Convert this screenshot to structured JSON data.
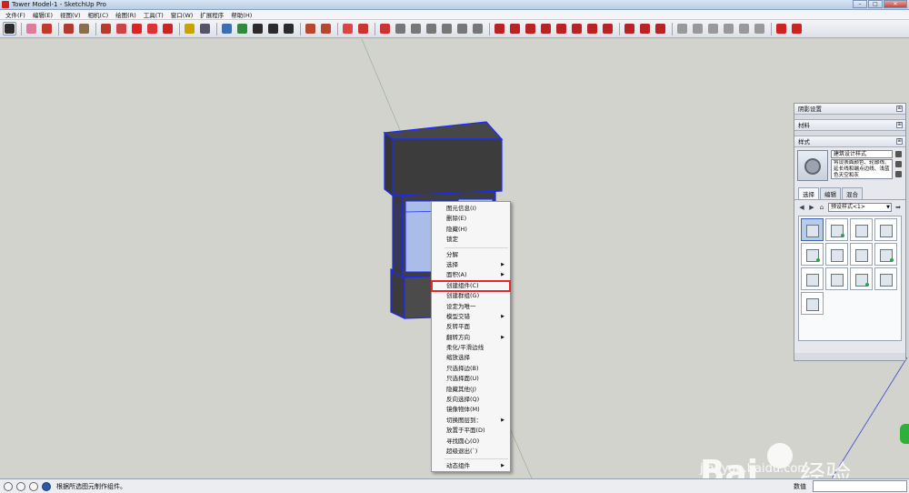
{
  "window": {
    "title": "Tower Model-1 - SketchUp Pro",
    "minimize": "–",
    "maximize": "□",
    "close": "✕"
  },
  "menubar": [
    "文件(F)",
    "编辑(E)",
    "视图(V)",
    "相机(C)",
    "绘图(R)",
    "工具(T)",
    "窗口(W)",
    "扩展程序",
    "帮助(H)"
  ],
  "toolbar": {
    "tools": [
      {
        "icon": "select-arrow-icon",
        "color": "#2b2b2b",
        "active": true
      },
      {
        "icon": "eraser-icon",
        "color": "#e07b9a"
      },
      {
        "icon": "pencil-line-icon",
        "color": "#c23a2a"
      },
      {
        "icon": "arc-icon",
        "color": "#b03a2e"
      },
      {
        "icon": "rectangle-icon",
        "color": "#8c6e4a"
      },
      {
        "icon": "push-pull-icon",
        "color": "#b83a2a"
      },
      {
        "icon": "follow-me-icon",
        "color": "#c44"
      },
      {
        "icon": "move-icon",
        "color": "#d22"
      },
      {
        "icon": "rotate-icon",
        "color": "#d33"
      },
      {
        "icon": "scale-icon",
        "color": "#c22"
      },
      {
        "icon": "tape-measure-icon",
        "color": "#c9a400"
      },
      {
        "icon": "text-icon",
        "color": "#556"
      },
      {
        "icon": "paint-bucket-icon",
        "color": "#3a6fb0"
      },
      {
        "icon": "orbit-icon",
        "color": "#2e8b3a"
      },
      {
        "icon": "pan-icon",
        "color": "#2b2b2b"
      },
      {
        "icon": "zoom-icon",
        "color": "#2b2b2b"
      },
      {
        "icon": "zoom-extents-icon",
        "color": "#2b2b2b"
      },
      {
        "icon": "warehouse-icon",
        "color": "#b5482e"
      },
      {
        "icon": "extension-warehouse-icon",
        "color": "#b5482e"
      },
      {
        "icon": "layout-icon",
        "color": "#d44"
      },
      {
        "icon": "iso-view-icon",
        "color": "#c33"
      },
      {
        "icon": "top-view-icon",
        "color": "#c33"
      },
      {
        "icon": "front-view-icon",
        "color": "#777"
      },
      {
        "icon": "right-view-icon",
        "color": "#777"
      },
      {
        "icon": "back-view-icon",
        "color": "#777"
      },
      {
        "icon": "left-view-icon",
        "color": "#777"
      },
      {
        "icon": "xray-icon",
        "color": "#777"
      },
      {
        "icon": "sandbox-icon",
        "color": "#777"
      },
      {
        "icon": "intersect-icon",
        "color": "#b22"
      },
      {
        "icon": "union-icon",
        "color": "#b22"
      },
      {
        "icon": "subtract-icon",
        "color": "#b22"
      },
      {
        "icon": "trim-icon",
        "color": "#b22"
      },
      {
        "icon": "split-icon",
        "color": "#b22"
      },
      {
        "icon": "outer-shell-icon",
        "color": "#b22"
      },
      {
        "icon": "section-plane-icon",
        "color": "#b22"
      },
      {
        "icon": "weld-icon",
        "color": "#b22"
      },
      {
        "icon": "smoove-icon",
        "color": "#b22"
      },
      {
        "icon": "stamp-icon",
        "color": "#b22"
      },
      {
        "icon": "drape-icon",
        "color": "#b22"
      },
      {
        "icon": "add-detail-icon",
        "color": "#999"
      },
      {
        "icon": "flip-edge-icon",
        "color": "#999"
      },
      {
        "icon": "shadows-icon",
        "color": "#999"
      },
      {
        "icon": "fog-icon",
        "color": "#999"
      },
      {
        "icon": "match-photo-icon",
        "color": "#999"
      },
      {
        "icon": "geo-location-icon",
        "color": "#999"
      },
      {
        "icon": "dynamic-component-icon",
        "color": "#c22"
      },
      {
        "icon": "ruby-console-icon",
        "color": "#c22"
      }
    ]
  },
  "context_menu": {
    "items": [
      {
        "label": "图元信息(I)",
        "sep_before": false,
        "submenu": false
      },
      {
        "label": "删除(E)",
        "sep_before": false,
        "submenu": false
      },
      {
        "label": "隐藏(H)",
        "sep_before": false,
        "submenu": false
      },
      {
        "label": "锁定",
        "sep_before": false,
        "submenu": false
      },
      {
        "label": "分解",
        "sep_before": true,
        "submenu": false
      },
      {
        "label": "选择",
        "sep_before": false,
        "submenu": true
      },
      {
        "label": "面积(A)",
        "sep_before": false,
        "submenu": true
      },
      {
        "label": "创建组件(C)",
        "sep_before": false,
        "submenu": false,
        "highlighted": true
      },
      {
        "label": "创建群组(G)",
        "sep_before": false,
        "submenu": false
      },
      {
        "label": "设定为唯一",
        "sep_before": false,
        "submenu": false
      },
      {
        "label": "模型交错",
        "sep_before": false,
        "submenu": true
      },
      {
        "label": "反转平面",
        "sep_before": false,
        "submenu": false
      },
      {
        "label": "翻转方向",
        "sep_before": false,
        "submenu": true
      },
      {
        "label": "柔化/平滑边线",
        "sep_before": false,
        "submenu": false
      },
      {
        "label": "缩放选择",
        "sep_before": false,
        "submenu": false
      },
      {
        "label": "只选择边(B)",
        "sep_before": false,
        "submenu": false
      },
      {
        "label": "只选择面(U)",
        "sep_before": false,
        "submenu": false
      },
      {
        "label": "隐藏其他(J)",
        "sep_before": false,
        "submenu": false
      },
      {
        "label": "反向选择(Q)",
        "sep_before": false,
        "submenu": false
      },
      {
        "label": "镜像物体(M)",
        "sep_before": false,
        "submenu": false
      },
      {
        "label": "切换图层到：",
        "sep_before": false,
        "submenu": true
      },
      {
        "label": "放置于平面(D)",
        "sep_before": false,
        "submenu": false
      },
      {
        "label": "寻找圆心(O)",
        "sep_before": false,
        "submenu": false
      },
      {
        "label": "超级退出(`)",
        "sep_before": false,
        "submenu": false
      },
      {
        "label": "动态组件",
        "sep_before": true,
        "submenu": true
      }
    ]
  },
  "tray": {
    "panels": [
      "阴影设置",
      "材料",
      "样式"
    ],
    "style": {
      "name": "建筑设计样式",
      "description": "将设表面颜色、轮廓线、延长线和端点边线、浅蓝色天空和灰"
    },
    "tabs": [
      "选择",
      "编辑",
      "混合"
    ],
    "library": "预设样式<1>",
    "thumb_count": 13,
    "selected_index": 0
  },
  "status": {
    "message": "根据所选图元制作组件。",
    "measure_label": "数值",
    "measure_value": ""
  },
  "watermark": {
    "brand": "Bai",
    "brand2": "经验",
    "url": "jingyan.baidu.com"
  }
}
